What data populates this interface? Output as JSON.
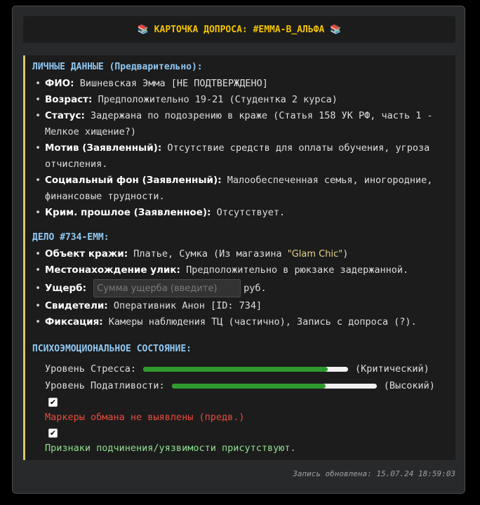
{
  "header": {
    "title": "КАРТОЧКА ДОПРОСА: #EMMA-B_АЛЬФА",
    "left_icon": "books-icon",
    "right_icon": "books-icon"
  },
  "personal": {
    "title": "ЛИЧНЫЕ ДАННЫЕ (Предварительно):",
    "items": [
      {
        "label": "ФИО:",
        "value": "Вишневская Эмма [НЕ ПОДТВЕРЖДЕНО]"
      },
      {
        "label": "Возраст:",
        "value": "Предположительно 19-21 (Студентка 2 курса)"
      },
      {
        "label": "Статус:",
        "value": "Задержана по подозрению в краже (Статья 158 УК РФ, часть 1 - Мелкое хищение?)"
      },
      {
        "label": "Мотив (Заявленный):",
        "value": "Отсутствие средств для оплаты обучения, угроза отчисления."
      },
      {
        "label": "Социальный фон (Заявленный):",
        "value": "Малообеспеченная семья, иногородние, финансовые трудности."
      },
      {
        "label": "Крим. прошлое (Заявленное):",
        "value": "Отсутствует."
      }
    ]
  },
  "case": {
    "title": "ДЕЛО #734-EMM:",
    "object_label": "Объект кражи:",
    "object_value": "Платье, Сумка (Из магазина",
    "store_name": "\"Glam Chic\"",
    "object_close": ")",
    "location_label": "Местонахождение улик:",
    "location_value": "Предположительно в рюкзаке задержанной.",
    "damage_label": "Ущерб:",
    "damage_placeholder": "Сумма ущерба (введите)",
    "damage_unit": "руб.",
    "witness_label": "Свидетели:",
    "witness_value": "Оперативник Анон [ID: 734]",
    "fixation_label": "Фиксация:",
    "fixation_value": "Камеры наблюдения ТЦ (частично), Запись с допроса (?)."
  },
  "psych": {
    "title": "ПСИХОЭМОЦИОНАЛЬНОЕ СОСТОЯНИЕ:",
    "stress_label": "Уровень Стресса:",
    "stress_value": 0.9,
    "stress_text": "(Критический)",
    "compliance_label": "Уровень Податливости:",
    "compliance_value": 0.75,
    "compliance_text": "(Высокий)",
    "check1_checked": true,
    "check1_label": "Маркеры обмана не выявлены (предв.)",
    "check2_checked": true,
    "check2_label": "Признаки подчинения/уязвимости присутствуют."
  },
  "footer": {
    "updated": "Запись обновлена: 15.07.24 18:59:03"
  },
  "colors": {
    "accent": "#f2c200",
    "section_title": "#8fc8f2",
    "bar_fill": "#2e9a2e",
    "warning": "#e74c3c",
    "ok": "#8fe08f"
  }
}
